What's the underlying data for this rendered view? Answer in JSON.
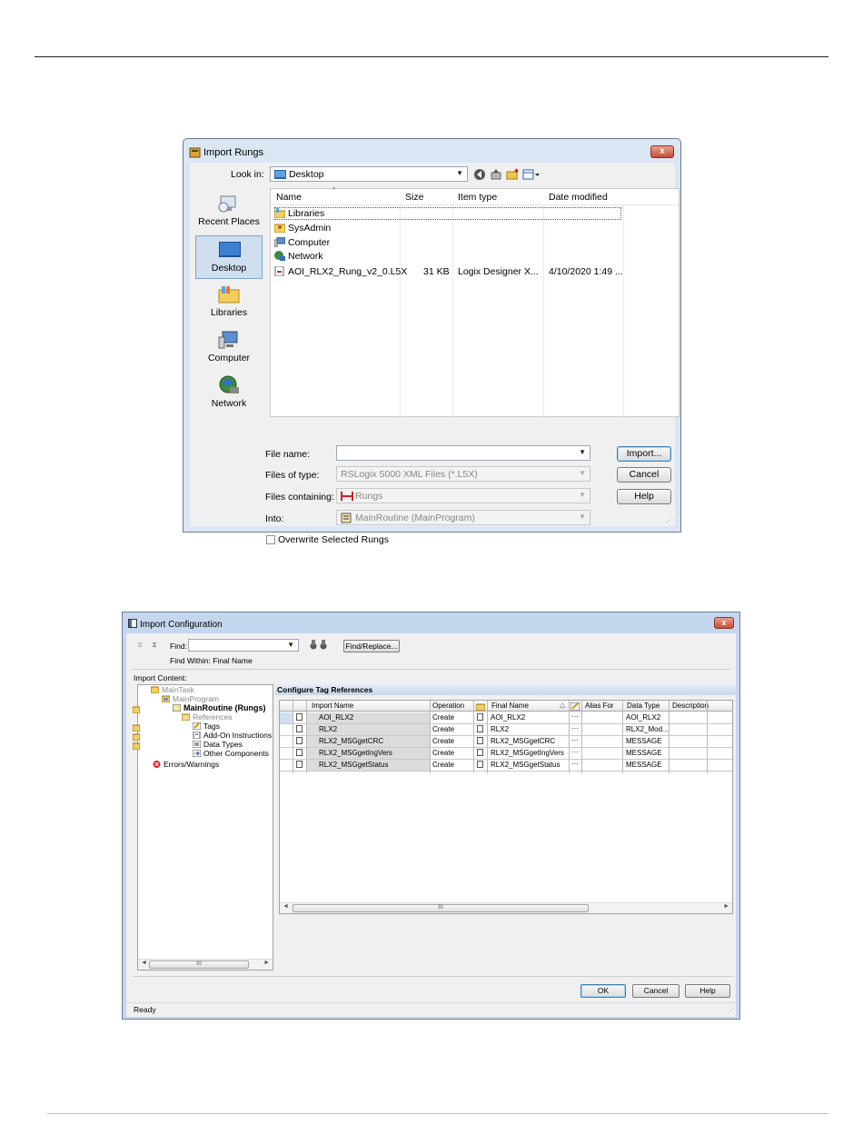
{
  "import_rungs": {
    "title": "Import Rungs",
    "close_label": "x",
    "look_in_label": "Look in:",
    "look_in_value": "Desktop",
    "places": [
      "Recent Places",
      "Desktop",
      "Libraries",
      "Computer",
      "Network"
    ],
    "columns": [
      "Name",
      "Size",
      "Item type",
      "Date modified"
    ],
    "files": [
      {
        "name": "Libraries",
        "size": "",
        "type": "",
        "date": ""
      },
      {
        "name": "SysAdmin",
        "size": "",
        "type": "",
        "date": ""
      },
      {
        "name": "Computer",
        "size": "",
        "type": "",
        "date": ""
      },
      {
        "name": "Network",
        "size": "",
        "type": "",
        "date": ""
      },
      {
        "name": "AOI_RLX2_Rung_v2_0.L5X",
        "size": "31 KB",
        "type": "Logix Designer X...",
        "date": "4/10/2020 1:49 ..."
      }
    ],
    "file_name_label": "File name:",
    "file_name_value": "",
    "files_of_type_label": "Files of type:",
    "files_of_type_value": "RSLogix 5000 XML Files (*.L5X)",
    "files_containing_label": "Files containing:",
    "files_containing_value": "Rungs",
    "into_label": "Into:",
    "into_value": "MainRoutine (MainProgram)",
    "overwrite_label": "Overwrite Selected Rungs",
    "overwrite_checked": false,
    "buttons": {
      "import": "Import...",
      "cancel": "Cancel",
      "help": "Help"
    }
  },
  "import_config": {
    "title": "Import Configuration",
    "close_label": "x",
    "find_label": "Find:",
    "find_value": "",
    "find_within": "Find Within: Final Name",
    "find_replace_label": "Find/Replace...",
    "import_content_label": "Import Content:",
    "tree": [
      "MainTask",
      "MainProgram",
      "MainRoutine (Rungs)",
      "References",
      "Tags",
      "Add-On Instructions",
      "Data Types",
      "Other Components",
      "Errors/Warnings"
    ],
    "tree_scroll": "III",
    "section_title": "Configure Tag References",
    "columns": [
      "Import Name",
      "Operation",
      "Final Name",
      "Alias For",
      "Data Type",
      "Description"
    ],
    "rows": [
      {
        "import_name": "AOI_RLX2",
        "operation": "Create",
        "final_name": "AOI_RLX2",
        "alias_for": "",
        "data_type": "AOI_RLX2",
        "description": ""
      },
      {
        "import_name": "RLX2",
        "operation": "Create",
        "final_name": "RLX2",
        "alias_for": "",
        "data_type": "RLX2_Mod...",
        "description": ""
      },
      {
        "import_name": "RLX2_MSGgetCRC",
        "operation": "Create",
        "final_name": "RLX2_MSGgetCRC",
        "alias_for": "",
        "data_type": "MESSAGE",
        "description": ""
      },
      {
        "import_name": "RLX2_MSGgetIngVers",
        "operation": "Create",
        "final_name": "RLX2_MSGgetIngVers",
        "alias_for": "",
        "data_type": "MESSAGE",
        "description": ""
      },
      {
        "import_name": "RLX2_MSGgetStatus",
        "operation": "Create",
        "final_name": "RLX2_MSGgetStatus",
        "alias_for": "",
        "data_type": "MESSAGE",
        "description": ""
      }
    ],
    "grid_scroll": "III",
    "buttons": {
      "ok": "OK",
      "cancel": "Cancel",
      "help": "Help"
    },
    "status": "Ready"
  }
}
